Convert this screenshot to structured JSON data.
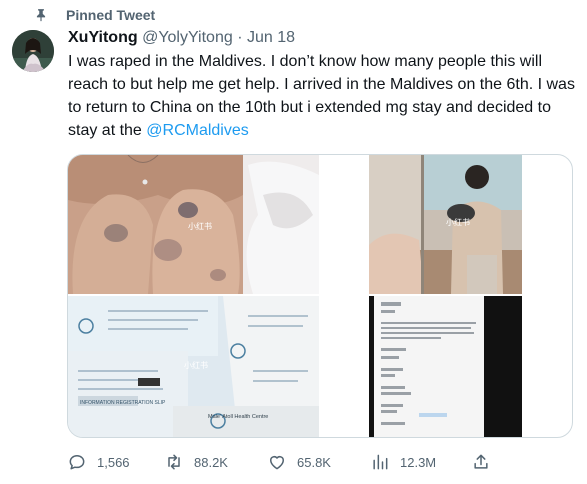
{
  "pinned_label": "Pinned Tweet",
  "author": {
    "display_name": "XuYitong",
    "handle": "@YolyYitong",
    "separator": "·",
    "date": "Jun 18"
  },
  "tweet": {
    "text": "I was raped in the Maldives. I don’t know how many people this will reach to but help me get help. I arrived in the Maldives on the 6th. I was to return to China on the 10th but i extended mg stay and decided to stay at the ",
    "mention": "@RCMaldives"
  },
  "media": {
    "watermarks": [
      "小红书",
      "小红书",
      "小红书"
    ],
    "photo_2_texts": {
      "form_title": "INFORMATION REGISTRATION SLIP",
      "clinic_name": "Male' Atoll Health Centre"
    }
  },
  "actions": {
    "replies": "1,566",
    "retweets": "88.2K",
    "likes": "65.8K",
    "views": "12.3M"
  },
  "colors": {
    "accent": "#1d9bf0",
    "secondary_text": "#536471",
    "border": "#cfd9de"
  },
  "icons": {
    "pin": "pin-icon",
    "reply": "reply-icon",
    "retweet": "retweet-icon",
    "like": "heart-icon",
    "views": "views-icon",
    "share": "share-icon"
  }
}
